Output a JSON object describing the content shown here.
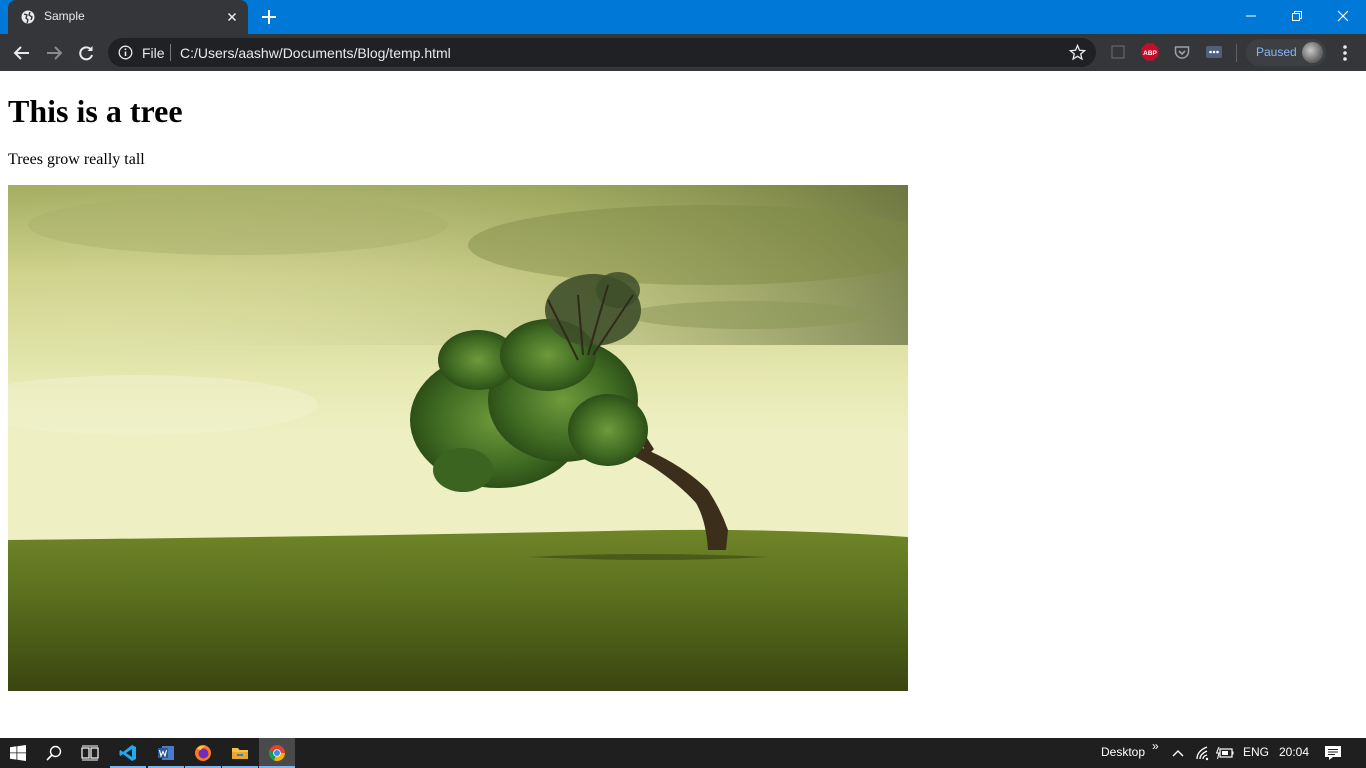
{
  "browser": {
    "tab": {
      "title": "Sample",
      "favicon": "globe-icon",
      "close_icon": "close-icon"
    },
    "new_tab_icon": "plus-icon",
    "window_controls": [
      "minimize-icon",
      "restore-icon",
      "close-icon"
    ],
    "toolbar": {
      "back_icon": "arrow-left-icon",
      "forward_icon": "arrow-right-icon",
      "reload_icon": "reload-icon",
      "address": {
        "info_icon": "info-icon",
        "scheme": "File",
        "url": "C:/Users/aashw/Documents/Blog/temp.html",
        "bookmark_icon": "star-icon"
      },
      "extensions": [
        "extension-square-icon",
        "adblock-icon",
        "pocket-icon",
        "more-extension-icon"
      ],
      "adblock_label": "ABP",
      "profile": {
        "label": "Paused",
        "avatar": "profile-avatar"
      },
      "menu_icon": "kebab-menu-icon"
    },
    "accent_color": "#0078d7",
    "frame_color": "#35363a"
  },
  "page": {
    "heading": "This is a tree",
    "paragraph": "Trees grow really tall",
    "image": {
      "subject": "tree-photo"
    }
  },
  "taskbar": {
    "apps": [
      "windows-start-icon",
      "search-icon",
      "task-view-icon",
      "vscode-icon",
      "word-icon",
      "firefox-icon",
      "file-explorer-icon",
      "chrome-icon"
    ],
    "desktop_label": "Desktop",
    "chevron": "»",
    "language": "ENG",
    "time": "20:04",
    "tray_icons": [
      "chevron-up-icon",
      "wifi-icon",
      "battery-icon",
      "notification-icon"
    ]
  }
}
